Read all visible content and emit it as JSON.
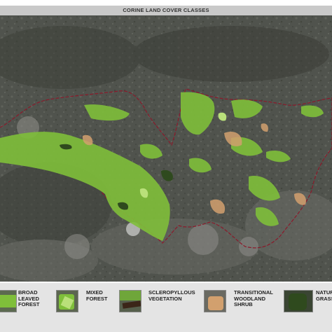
{
  "title": "CORINE LAND COVER CLASSES",
  "colors": {
    "broad_leaved_forest": "#7fbf3a",
    "mixed_forest": "#b9e07a",
    "sclerophyllous_vegetation": "#6fa63a",
    "transitional_woodland_shrub": "#d2a06e",
    "natural_grassland": "#2f4a1e",
    "boundary": "#8b1a2b",
    "satellite_base": "#4f524c"
  },
  "legend": [
    {
      "id": "broad-leaved-forest",
      "lines": [
        "BROAD",
        "LEAVED",
        "FOREST"
      ]
    },
    {
      "id": "mixed-forest",
      "lines": [
        "MIXED",
        "FOREST"
      ]
    },
    {
      "id": "sclerophyllous-vegetation",
      "lines": [
        "SCLEROPYLLOUS",
        "VEGETATION"
      ]
    },
    {
      "id": "transitional-woodland-shrub",
      "lines": [
        "TRANSITIONAL",
        "WOODLAND",
        "SHRUB"
      ]
    },
    {
      "id": "natural-grassland",
      "lines": [
        "NATUR",
        "GRASS"
      ]
    }
  ]
}
